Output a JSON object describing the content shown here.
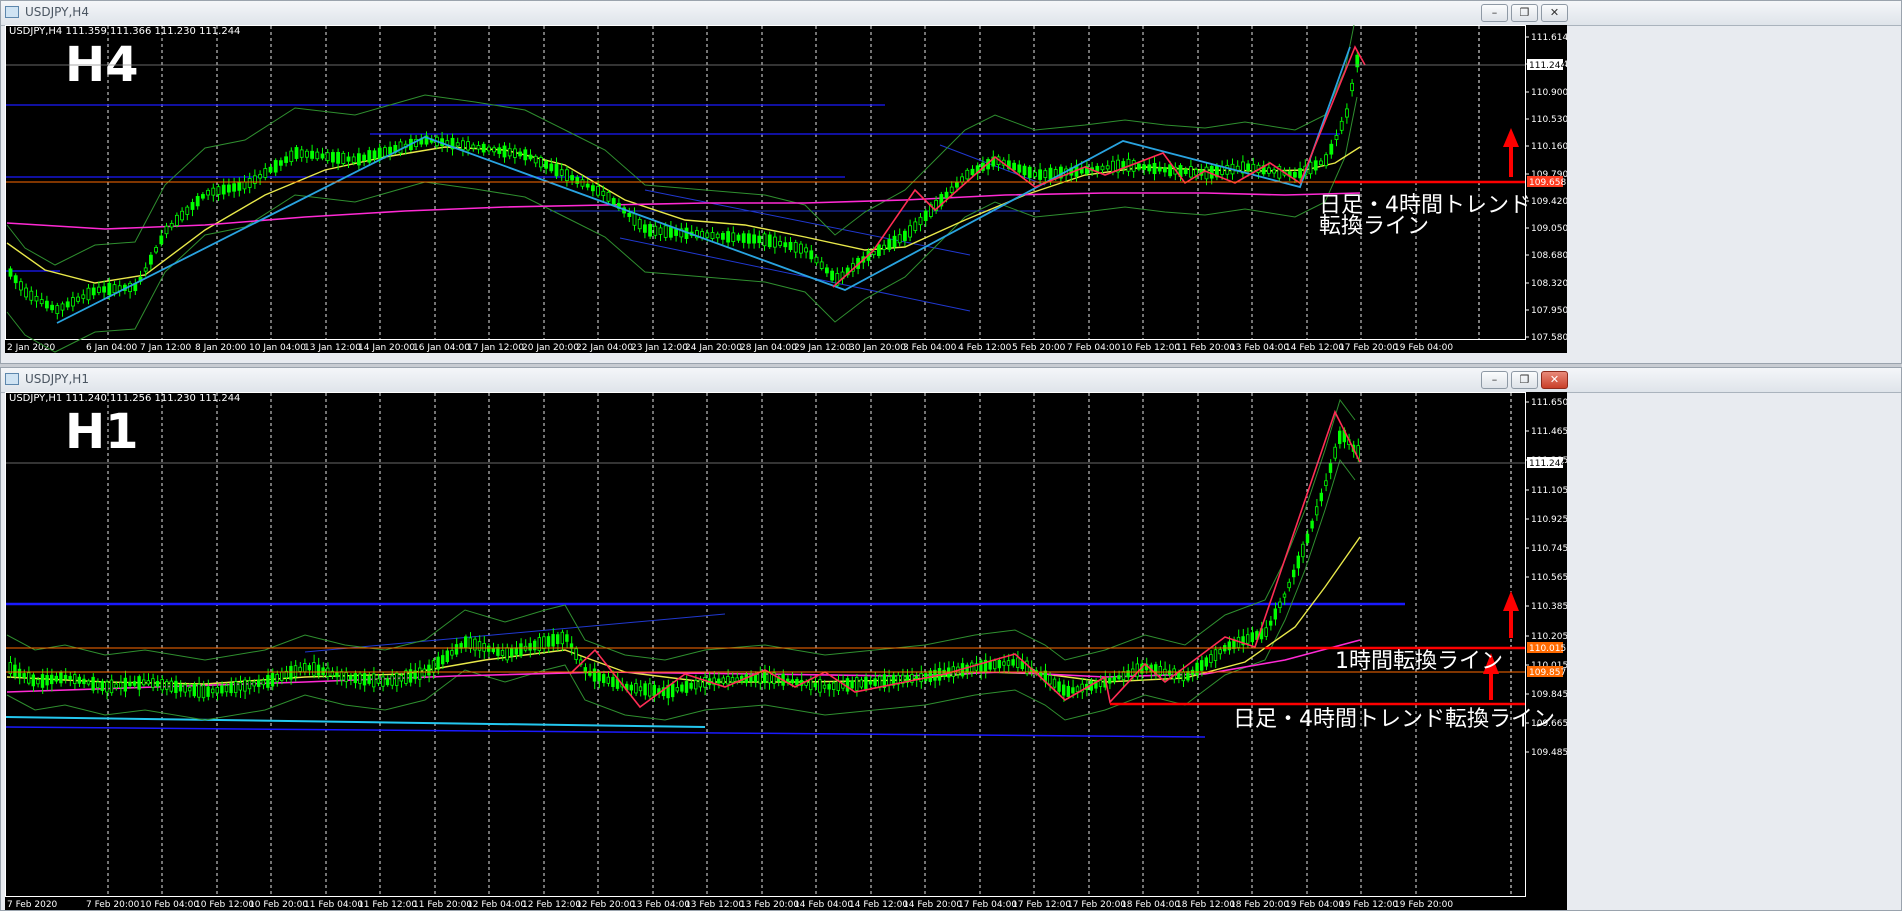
{
  "windows": [
    {
      "id": "h4",
      "title": "USDJPY,H4",
      "symbol_line": "USDJPY,H4   111.359 111.366 111.230 111.244",
      "timeframe_label": "H4",
      "current_price_label": "111.244",
      "price_ticks": [
        "111.614",
        "111.244",
        "110.900",
        "110.530",
        "110.160",
        "109.790",
        "109.420",
        "109.050",
        "108.680",
        "108.320",
        "107.950",
        "107.580"
      ],
      "time_ticks": [
        "2 Jan 2020",
        "6 Jan 04:00",
        "7 Jan 12:00",
        "8 Jan 20:00",
        "10 Jan 04:00",
        "13 Jan 12:00",
        "14 Jan 20:00",
        "16 Jan 04:00",
        "17 Jan 12:00",
        "20 Jan 20:00",
        "22 Jan 04:00",
        "23 Jan 12:00",
        "24 Jan 20:00",
        "28 Jan 04:00",
        "29 Jan 12:00",
        "30 Jan 20:00",
        "3 Feb 04:00",
        "4 Feb 12:00",
        "5 Feb 20:00",
        "7 Feb 04:00",
        "10 Feb 12:00",
        "11 Feb 20:00",
        "13 Feb 04:00",
        "14 Feb 12:00",
        "17 Feb 20:00",
        "19 Feb 04:00"
      ],
      "levels": [
        {
          "label": "109.658",
          "color": "#ff3b1f"
        }
      ],
      "annotations": [
        {
          "text": "日足・4時間トレンド"
        },
        {
          "text": "転換ライン"
        }
      ]
    },
    {
      "id": "h1",
      "title": "USDJPY,H1",
      "symbol_line": "USDJPY,H1   111.240 111.256 111.230 111.244",
      "timeframe_label": "H1",
      "current_price_label": "111.244",
      "price_ticks": [
        "111.650",
        "111.465",
        "111.285",
        "111.105",
        "110.925",
        "110.745",
        "110.565",
        "110.385",
        "110.205",
        "110.015",
        "109.845",
        "109.665",
        "109.485"
      ],
      "time_ticks": [
        "7 Feb 2020",
        "7 Feb 20:00",
        "10 Feb 04:00",
        "10 Feb 12:00",
        "10 Feb 20:00",
        "11 Feb 04:00",
        "11 Feb 12:00",
        "11 Feb 20:00",
        "12 Feb 04:00",
        "12 Feb 12:00",
        "12 Feb 20:00",
        "13 Feb 04:00",
        "13 Feb 12:00",
        "13 Feb 20:00",
        "14 Feb 04:00",
        "14 Feb 12:00",
        "14 Feb 20:00",
        "17 Feb 04:00",
        "17 Feb 12:00",
        "17 Feb 20:00",
        "18 Feb 04:00",
        "18 Feb 12:00",
        "18 Feb 20:00",
        "19 Feb 04:00",
        "19 Feb 12:00",
        "19 Feb 20:00"
      ],
      "levels": [
        {
          "label": "110.015",
          "color": "#ff6a00"
        },
        {
          "label": "109.857",
          "color": "#ff6a00"
        }
      ],
      "annotations": [
        {
          "text": "1時間転換ライン"
        },
        {
          "text": "日足・4時間トレンド転換ライン"
        }
      ]
    }
  ],
  "colors": {
    "background": "#000000",
    "grid": "#ffffff",
    "bull_candle": "#00ff00",
    "bear_candle": "#00ff00",
    "wave_blue": "#29a3e0",
    "wave_red": "#ff2d55",
    "ma_yellow": "#e8e84a",
    "ma_magenta": "#ff2ad4",
    "bollinger": "#2f8f2f",
    "hline_blue": "#1a1aff",
    "arrow": "#ff0000"
  },
  "icons": [
    "app-icon",
    "minimize-icon",
    "restore-icon",
    "close-icon"
  ]
}
